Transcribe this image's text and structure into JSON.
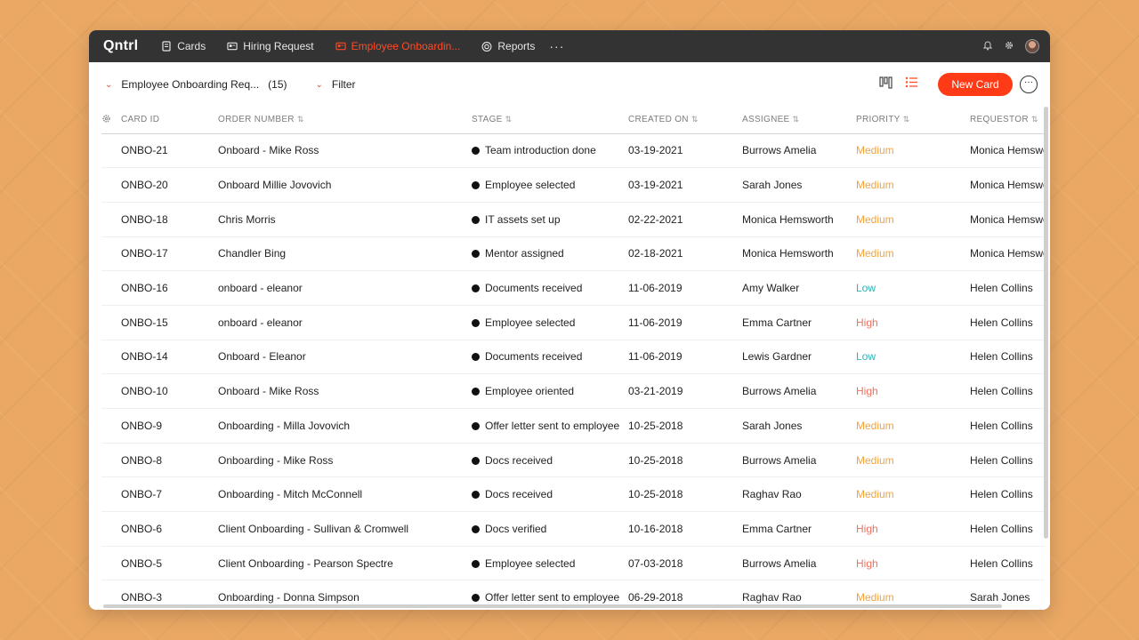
{
  "app": {
    "logo": "Qntrl"
  },
  "nav": {
    "tabs": [
      {
        "label": "Cards",
        "icon": "cards-icon",
        "active": false
      },
      {
        "label": "Hiring Request",
        "icon": "form-icon",
        "active": false
      },
      {
        "label": "Employee Onboardin...",
        "icon": "form-icon",
        "active": true
      },
      {
        "label": "Reports",
        "icon": "reports-icon",
        "active": false
      }
    ],
    "more": "···"
  },
  "toolbar": {
    "view_name": "Employee Onboarding Req...",
    "view_count": "(15)",
    "filter_label": "Filter",
    "new_card_label": "New Card",
    "more_label": "···"
  },
  "table": {
    "columns": [
      "CARD ID",
      "ORDER NUMBER",
      "STAGE",
      "CREATED ON",
      "ASSIGNEE",
      "PRIORITY",
      "REQUESTOR"
    ],
    "rows": [
      {
        "card_id": "ONBO-21",
        "order": "Onboard - Mike Ross",
        "stage": "Team introduction done",
        "created": "03-19-2021",
        "assignee": "Burrows Amelia",
        "priority": "Medium",
        "requestor": "Monica Hemsworth"
      },
      {
        "card_id": "ONBO-20",
        "order": "Onboard Millie Jovovich",
        "stage": "Employee selected",
        "created": "03-19-2021",
        "assignee": "Sarah Jones",
        "priority": "Medium",
        "requestor": "Monica Hemsworth"
      },
      {
        "card_id": "ONBO-18",
        "order": "Chris Morris",
        "stage": "IT assets set up",
        "created": "02-22-2021",
        "assignee": "Monica Hemsworth",
        "priority": "Medium",
        "requestor": "Monica Hemsworth"
      },
      {
        "card_id": "ONBO-17",
        "order": "Chandler Bing",
        "stage": "Mentor assigned",
        "created": "02-18-2021",
        "assignee": "Monica Hemsworth",
        "priority": "Medium",
        "requestor": "Monica Hemsworth"
      },
      {
        "card_id": "ONBO-16",
        "order": "onboard - eleanor",
        "stage": "Documents received",
        "created": "11-06-2019",
        "assignee": "Amy Walker",
        "priority": "Low",
        "requestor": "Helen Collins"
      },
      {
        "card_id": "ONBO-15",
        "order": "onboard - eleanor",
        "stage": "Employee selected",
        "created": "11-06-2019",
        "assignee": "Emma Cartner",
        "priority": "High",
        "requestor": "Helen Collins"
      },
      {
        "card_id": "ONBO-14",
        "order": "Onboard - Eleanor",
        "stage": "Documents received",
        "created": "11-06-2019",
        "assignee": "Lewis Gardner",
        "priority": "Low",
        "requestor": "Helen Collins"
      },
      {
        "card_id": "ONBO-10",
        "order": "Onboard - Mike Ross",
        "stage": "Employee oriented",
        "created": "03-21-2019",
        "assignee": "Burrows Amelia",
        "priority": "High",
        "requestor": "Helen Collins"
      },
      {
        "card_id": "ONBO-9",
        "order": "Onboarding - Milla Jovovich",
        "stage": "Offer letter sent to employee",
        "created": "10-25-2018",
        "assignee": "Sarah Jones",
        "priority": "Medium",
        "requestor": "Helen Collins"
      },
      {
        "card_id": "ONBO-8",
        "order": "Onboarding - Mike Ross",
        "stage": "Docs received",
        "created": "10-25-2018",
        "assignee": "Burrows Amelia",
        "priority": "Medium",
        "requestor": "Helen Collins"
      },
      {
        "card_id": "ONBO-7",
        "order": "Onboarding - Mitch McConnell",
        "stage": "Docs received",
        "created": "10-25-2018",
        "assignee": "Raghav Rao",
        "priority": "Medium",
        "requestor": "Helen Collins"
      },
      {
        "card_id": "ONBO-6",
        "order": "Client Onboarding - Sullivan & Cromwell",
        "stage": "Docs verified",
        "created": "10-16-2018",
        "assignee": "Emma Cartner",
        "priority": "High",
        "requestor": "Helen Collins"
      },
      {
        "card_id": "ONBO-5",
        "order": "Client Onboarding - Pearson Spectre",
        "stage": "Employee selected",
        "created": "07-03-2018",
        "assignee": "Burrows Amelia",
        "priority": "High",
        "requestor": "Helen Collins"
      },
      {
        "card_id": "ONBO-3",
        "order": "Onboarding - Donna Simpson",
        "stage": "Offer letter sent to employee",
        "created": "06-29-2018",
        "assignee": "Raghav Rao",
        "priority": "Medium",
        "requestor": "Sarah Jones"
      }
    ]
  },
  "colors": {
    "accent": "#ff3b17",
    "topbar": "#333333",
    "priority_medium": "#f2a33a",
    "priority_low": "#2ab5b5",
    "priority_high": "#f36f5e"
  }
}
